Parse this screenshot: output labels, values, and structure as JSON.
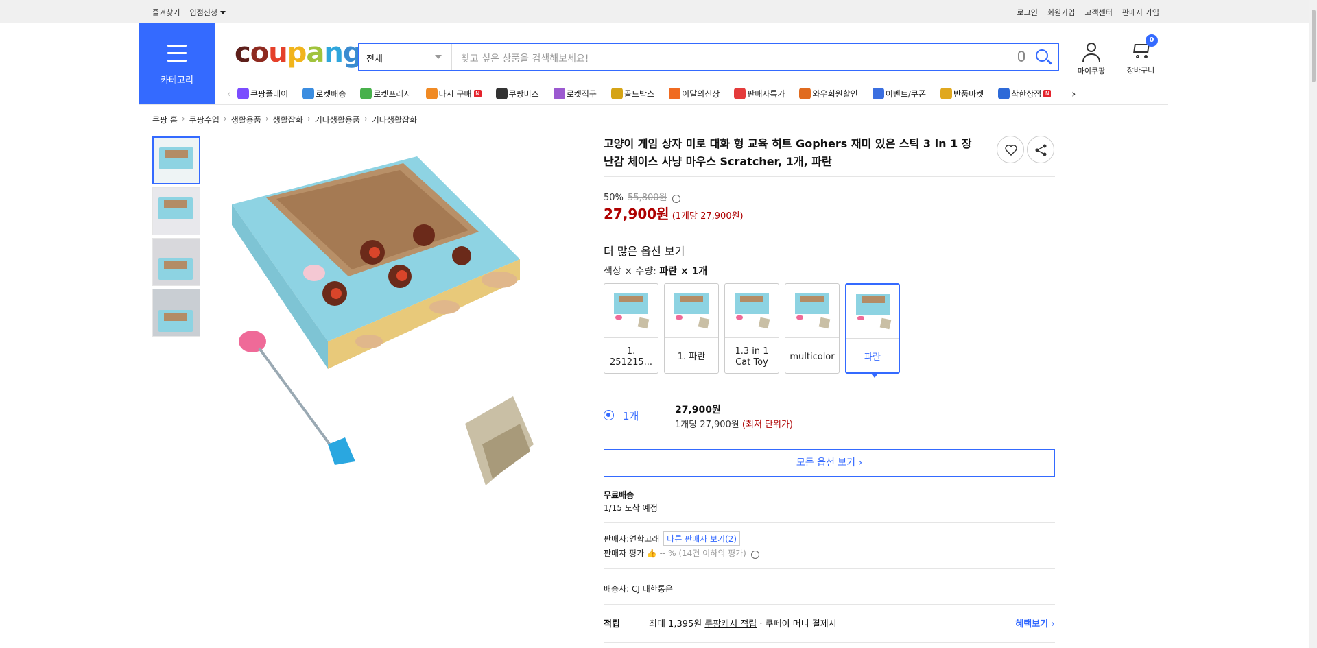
{
  "topbar": {
    "favorites": "즐겨찾기",
    "apply": "입점신청",
    "login": "로그인",
    "signup": "회원가입",
    "support": "고객센터",
    "seller_signup": "판매자 가입"
  },
  "header": {
    "category_label": "카테고리",
    "logo": [
      "c",
      "o",
      "u",
      "p",
      "a",
      "n",
      "g"
    ],
    "logo_colors": [
      "#5d1f1b",
      "#8e2a20",
      "#e5402a",
      "#f1b41b",
      "#a0c33b",
      "#2fa6dc",
      "#3a8bd0"
    ],
    "search_scope": "전체",
    "search_placeholder": "찾고 싶은 상품을 검색해보세요!",
    "mycoupang": "마이쿠팡",
    "cart": "장바구니",
    "cart_count": "0"
  },
  "nav": [
    {
      "label": "쿠팡플레이",
      "color": "#7b4dff",
      "new": false
    },
    {
      "label": "로켓배송",
      "color": "#3b8de0",
      "new": false
    },
    {
      "label": "로켓프레시",
      "color": "#48b14c",
      "new": false
    },
    {
      "label": "다시 구매",
      "color": "#f08a24",
      "new": true
    },
    {
      "label": "쿠팡비즈",
      "color": "#333333",
      "new": false
    },
    {
      "label": "로켓직구",
      "color": "#9b59d0",
      "new": false
    },
    {
      "label": "골드박스",
      "color": "#d5a416",
      "new": false
    },
    {
      "label": "이달의신상",
      "color": "#f06b21",
      "new": false
    },
    {
      "label": "판매자특가",
      "color": "#e43b3b",
      "new": false
    },
    {
      "label": "와우회원할인",
      "color": "#e06b1f",
      "new": false
    },
    {
      "label": "이벤트/쿠폰",
      "color": "#3b6fe0",
      "new": false
    },
    {
      "label": "반품마켓",
      "color": "#e0a81f",
      "new": false
    },
    {
      "label": "착한상점",
      "color": "#2e6ad8",
      "new": true
    }
  ],
  "breadcrumb": [
    "쿠팡 홈",
    "쿠팡수입",
    "생활용품",
    "생활잡화",
    "기타생활용품",
    "기타생활잡화"
  ],
  "product": {
    "title": "고양이 게임 상자 미로 대화 형 교육 히트 Gophers 재미 있은 스틱 3 in 1 장난감 체이스 사냥 마우스 Scratcher, 1개, 파란",
    "discount": "50%",
    "original_price": "55,800원",
    "price": "27,900원",
    "unit_price": "(1개당 27,900원)",
    "more_options": "더 많은 옵션 보기",
    "option_label": "색상 × 수량:",
    "option_value": "파란 × 1개",
    "options": [
      "1. 251215...",
      "1. 파란",
      "1.3 in 1 Cat Toy",
      "multicolor",
      "파란"
    ],
    "selected_option_index": 4,
    "qty_label": "1개",
    "qty_price": "27,900원",
    "qty_unit": "1개당 27,900원",
    "qty_lowest": "(최저 단위가)",
    "all_options": "모든 옵션 보기 ›",
    "shipping_type": "무료배송",
    "delivery": "1/15 도착 예정",
    "seller_label": "판매자:",
    "seller_name": "연학고래",
    "other_sellers": "다른 판매자 보기(2)",
    "seller_rating_label": "판매자 평가",
    "seller_rating_value": "-- %",
    "seller_rating_note": "(14건 이하의 평가)",
    "carrier_label": "배송사:",
    "carrier_name": "CJ 대한통운",
    "points_label": "적립",
    "points_max": "최대 1,395원",
    "points_cash": "쿠팡캐시 적립",
    "points_suffix": "· 쿠페이 머니 결제시",
    "benefit": "혜택보기 ›"
  }
}
